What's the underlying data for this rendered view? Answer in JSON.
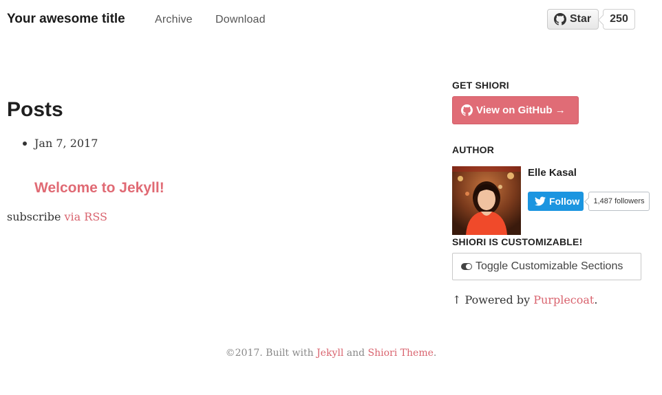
{
  "header": {
    "site_title": "Your awesome title",
    "nav": [
      "Archive",
      "Download"
    ],
    "github_star": {
      "label": "Star",
      "count": "250"
    }
  },
  "main": {
    "heading": "Posts",
    "posts": [
      {
        "date": "Jan 7, 2017",
        "title": "Welcome to Jekyll!"
      }
    ],
    "subscribe": {
      "text": "subscribe",
      "link": "via RSS"
    }
  },
  "sidebar": {
    "get_heading": "GET SHIORI",
    "github_button": "View on GitHub →",
    "author_heading": "AUTHOR",
    "author_name": "Elle Kasal",
    "twitter_follow": "Follow",
    "twitter_followers": "1,487 followers",
    "customizable_heading": "SHIORI IS CUSTOMIZABLE!",
    "toggle_button": "Toggle Customizable Sections",
    "powered_prefix": "↑ Powered by",
    "powered_link": "Purplecoat",
    "powered_suffix": "."
  },
  "footer": {
    "prefix": "©2017. Built with",
    "jekyll": "Jekyll",
    "and": "and",
    "theme": "Shiori Theme",
    "suffix": "."
  },
  "colors": {
    "accent": "#e06c76",
    "link": "#d9636e",
    "twitter": "#1b95e0"
  }
}
